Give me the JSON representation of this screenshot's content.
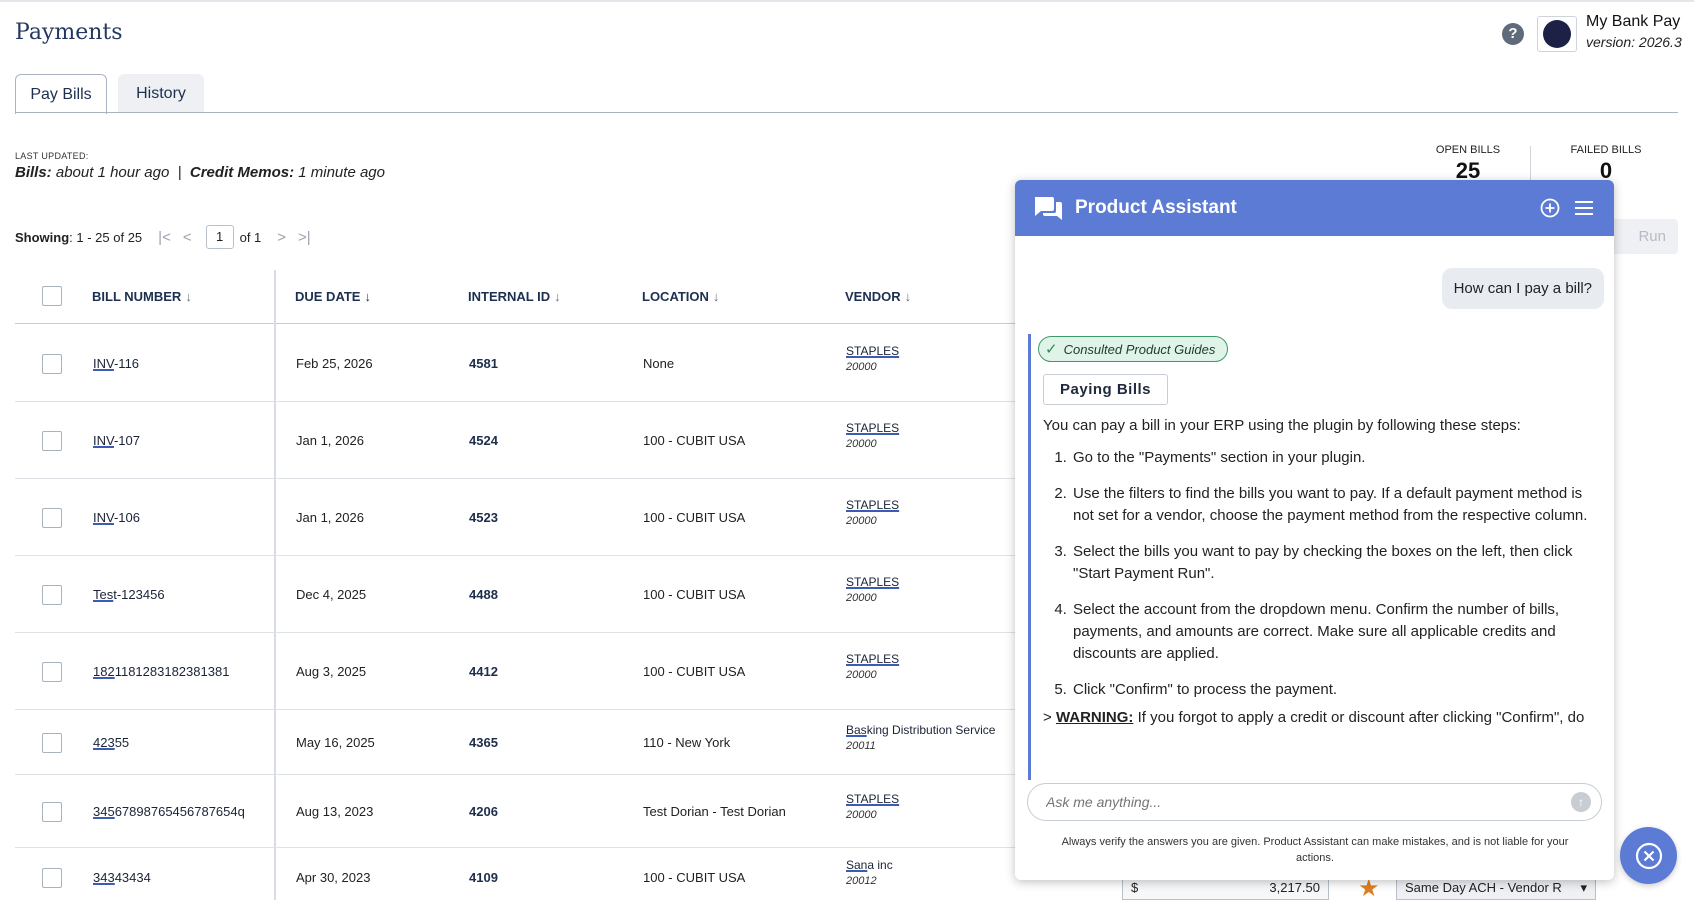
{
  "header": {
    "title": "Payments",
    "app_name": "My Bank Pay",
    "app_version": "version: 2026.3",
    "help": "?"
  },
  "tabs": [
    {
      "label": "Pay Bills",
      "active": true
    },
    {
      "label": "History",
      "active": false
    }
  ],
  "status": {
    "last_updated_label": "LAST UPDATED:",
    "bills_label": "Bills:",
    "bills_value": "about 1 hour ago",
    "separator": "|",
    "memos_label": "Credit Memos:",
    "memos_value": "1 minute ago"
  },
  "stats": {
    "open_label": "OPEN BILLS",
    "open_value": "25",
    "failed_label": "FAILED BILLS",
    "failed_value": "0"
  },
  "pager": {
    "showing_label": "Showing",
    "showing_value": ": 1 - 25 of 25",
    "page": "1",
    "of": "of 1"
  },
  "run_button": "Run",
  "columns": {
    "bill_number": "BILL NUMBER",
    "due_date": "DUE DATE",
    "internal_id": "INTERNAL ID",
    "location": "LOCATION",
    "vendor": "VENDOR"
  },
  "rows": [
    {
      "bill_u": "INV",
      "bill_rest": "-116",
      "due": "Feb 25, 2026",
      "iid": "4581",
      "loc": "None",
      "vendor_u": "STAPLES",
      "vendor_rest": "",
      "vendor_id": "20000"
    },
    {
      "bill_u": "INV",
      "bill_rest": "-107",
      "due": "Jan 1, 2026",
      "iid": "4524",
      "loc": "100 - CUBIT USA",
      "vendor_u": "STAPLES",
      "vendor_rest": "",
      "vendor_id": "20000"
    },
    {
      "bill_u": "INV",
      "bill_rest": "-106",
      "due": "Jan 1, 2026",
      "iid": "4523",
      "loc": "100 - CUBIT USA",
      "vendor_u": "STAPLES",
      "vendor_rest": "",
      "vendor_id": "20000"
    },
    {
      "bill_u": "Tes",
      "bill_rest": "t-123456",
      "due": "Dec 4, 2025",
      "iid": "4488",
      "loc": "100 - CUBIT USA",
      "vendor_u": "STAPLES",
      "vendor_rest": "",
      "vendor_id": "20000"
    },
    {
      "bill_u": "182",
      "bill_rest": "1181283182381381",
      "due": "Aug 3, 2025",
      "iid": "4412",
      "loc": "100 - CUBIT USA",
      "vendor_u": "STAPLES",
      "vendor_rest": "",
      "vendor_id": "20000"
    },
    {
      "bill_u": "423",
      "bill_rest": "55",
      "due": "May 16, 2025",
      "iid": "4365",
      "loc": "110 - New York",
      "vendor_u": "Bas",
      "vendor_rest": "king Distribution Service",
      "vendor_id": "20011"
    },
    {
      "bill_u": "345",
      "bill_rest": "67898765456787654q",
      "due": "Aug 13, 2023",
      "iid": "4206",
      "loc": "Test Dorian - Test Dorian",
      "vendor_u": "STAPLES",
      "vendor_rest": "",
      "vendor_id": "20000"
    },
    {
      "bill_u": "343",
      "bill_rest": "43434",
      "due": "Apr 30, 2023",
      "iid": "4109",
      "loc": "100 - CUBIT USA",
      "vendor_u": "San",
      "vendor_rest": "a inc",
      "vendor_id": "20012"
    }
  ],
  "bottom_row": {
    "currency": "$",
    "amount": "3,217.50",
    "method": "Same Day ACH - Vendor R"
  },
  "assistant": {
    "title": "Product Assistant",
    "user_question": "How can I pay a bill?",
    "consulted": "Consulted Product Guides",
    "guide_tag": "Paying Bills",
    "intro": "You can pay a bill in your ERP using the plugin by following these steps:",
    "steps": [
      "Go to the \"Payments\" section in your plugin.",
      "Use the filters to find the bills you want to pay. If a default payment method is not set for a vendor, choose the payment method from the respective column.",
      "Select the bills you want to pay by checking the boxes on the left, then click \"Start Payment Run\".",
      "Select the account from the dropdown menu. Confirm the number of bills, payments, and amounts are correct. Make sure all applicable credits and discounts are applied.",
      "Click \"Confirm\" to process the payment."
    ],
    "warning_label": "WARNING:",
    "warning_text": "If you forgot to apply a credit or discount after clicking \"Confirm\", do",
    "input_placeholder": "Ask me anything...",
    "disclaimer": "Always verify the answers you are given. Product Assistant can make mistakes, and is not liable for your actions."
  },
  "colors": {
    "accent": "#5b7bd5",
    "title": "#23385e",
    "success": "#3e9a67",
    "star": "#e07f20"
  },
  "icons": [
    "help-icon",
    "bank-logo-icon",
    "first-page-icon",
    "prev-page-icon",
    "next-page-icon",
    "last-page-icon",
    "sort-arrow-icon",
    "chat-icon",
    "new-chat-icon",
    "menu-icon",
    "check-icon",
    "send-icon",
    "close-icon",
    "star-icon",
    "chevron-down-icon"
  ]
}
